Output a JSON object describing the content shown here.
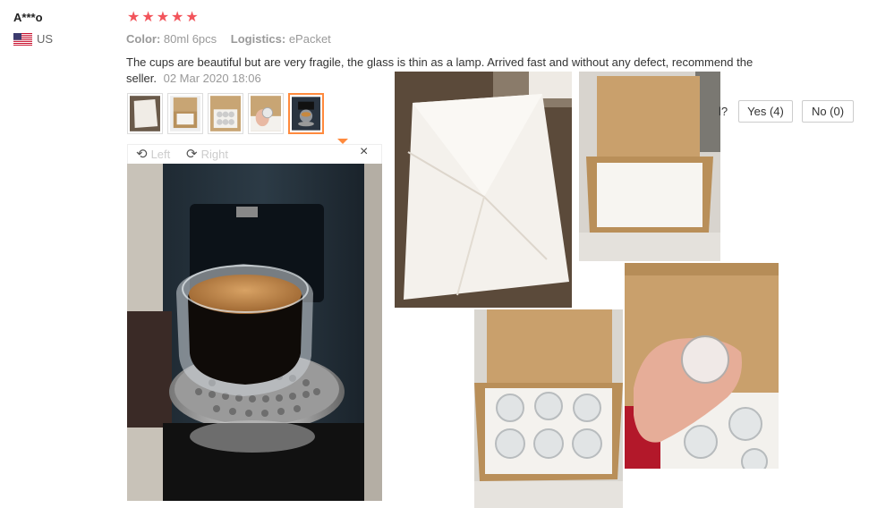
{
  "review": {
    "reviewer": "A***o",
    "country": "US",
    "rating": 5,
    "stars": [
      "★",
      "★",
      "★",
      "★",
      "★"
    ],
    "color_label": "Color:",
    "color_value": "80ml 6pcs",
    "logistics_label": "Logistics:",
    "logistics_value": "ePacket",
    "comment": "The cups are beautiful but are very fragile, the glass is thin as a lamp. Arrived fast and without any defect, recommend the seller.",
    "date": "02 Mar 2020 18:06"
  },
  "viewer": {
    "rotate_left_label": "Left",
    "rotate_right_label": "Right",
    "close_glyph": "×",
    "rotate_left_icon": "rotate-left-icon",
    "rotate_right_icon": "rotate-right-icon"
  },
  "helpful": {
    "question_fragment": "l?",
    "yes_label": "Yes (4)",
    "no_label": "No (0)"
  },
  "colors": {
    "star": "#f2545b",
    "selected_thumb_border": "#ff8a3d"
  }
}
